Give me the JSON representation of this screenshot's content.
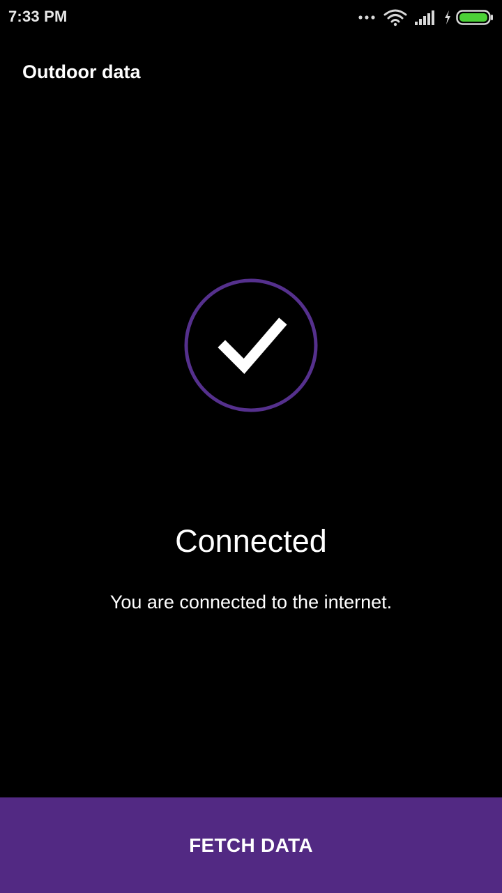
{
  "status_bar": {
    "time": "7:33 PM",
    "icons": [
      "more-dots-icon",
      "wifi-icon",
      "signal-icon",
      "charging-icon",
      "battery-icon"
    ]
  },
  "app_bar": {
    "title": "Outdoor data"
  },
  "status": {
    "icon": "checkmark-icon",
    "headline": "Connected",
    "message": "You are connected to the internet."
  },
  "actions": {
    "fetch_label": "FETCH DATA"
  },
  "colors": {
    "background": "#000000",
    "accent": "#522983",
    "ring": "#55308d",
    "text": "#ffffff",
    "battery": "#4cd137"
  }
}
